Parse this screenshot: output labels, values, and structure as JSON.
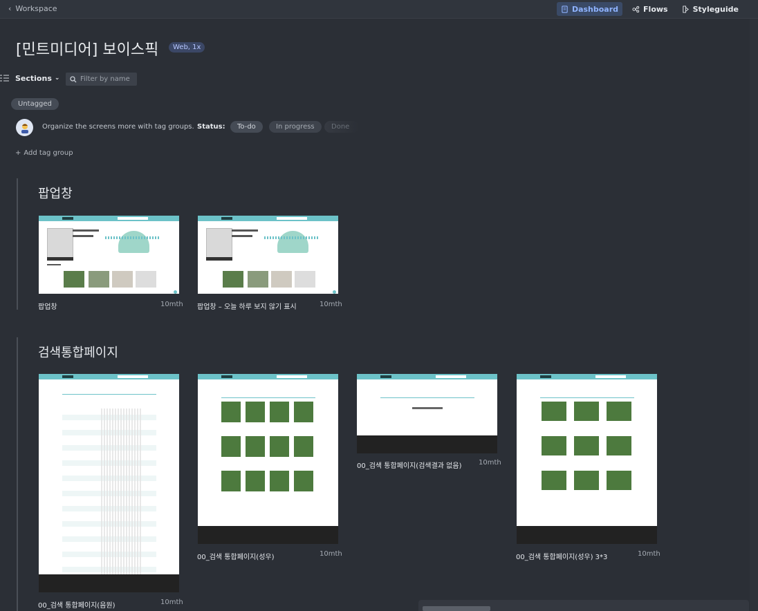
{
  "topbar": {
    "back_label": "Workspace",
    "nav": [
      {
        "label": "Dashboard",
        "icon": "dashboard-icon",
        "active": true
      },
      {
        "label": "Flows",
        "icon": "flows-icon",
        "active": false
      },
      {
        "label": "Styleguide",
        "icon": "styleguide-icon",
        "active": false
      }
    ]
  },
  "project": {
    "title": "[민트미디어] 보이스픽",
    "badge": "Web, 1x"
  },
  "toolbar": {
    "sections_label": "Sections",
    "filter_placeholder": "Filter by name"
  },
  "tags": {
    "untagged_label": "Untagged",
    "organize_text": "Organize the screens more with tag groups.",
    "status_label": "Status:",
    "status_pills": [
      "To-do",
      "In progress",
      "Done"
    ],
    "add_tag_group": "Add tag group"
  },
  "sections": [
    {
      "title": "팝업창",
      "screens": [
        {
          "name": "팝업창",
          "time": "10mth"
        },
        {
          "name": "팝업창 – 오늘 하루 보지 않기 표시",
          "time": "10mth"
        }
      ]
    },
    {
      "title": "검색통합페이지",
      "screens": [
        {
          "name": "00_검색 통합페이지(음원)",
          "time": "10mth"
        },
        {
          "name": "00_검색 통합페이지(성우)",
          "time": "10mth"
        },
        {
          "name": "00_검색 통합페이지(검색결과 없음)",
          "time": "10mth"
        },
        {
          "name": "00_검색 통합페이지(성우) 3*3",
          "time": "10mth"
        }
      ]
    }
  ],
  "colors": {
    "background": "#2b2f36",
    "accent": "#8fb3ff",
    "thumb_header": "#6cc2c8"
  }
}
